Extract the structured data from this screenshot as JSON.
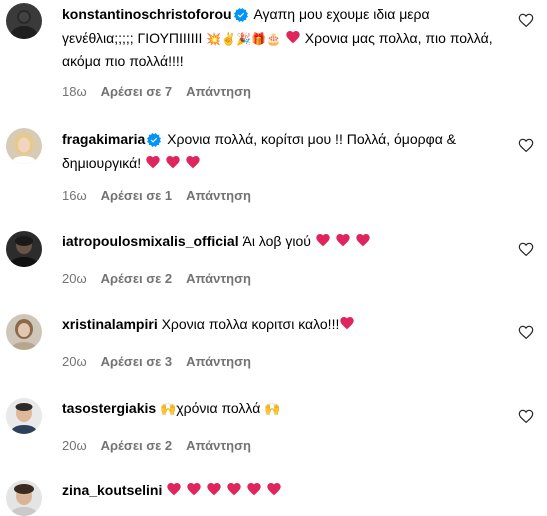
{
  "comments": [
    {
      "username": "konstantinoschristoforou",
      "verified": true,
      "text_before": "Αγαπη μου εχουμε ιδια μερα γενέθλια;;;;; ΓΙΟΥΠΙΙΙΙΙΙ ",
      "emojis_mid": "💥✌️🎉🎁🎂",
      "text_after": " Χρονια μας πολλα, πιο πολλά, ακόμα πιο πολλά!!!!",
      "time": "18ω",
      "likes": "Αρέσει σε 7",
      "reply": "Απάντηση"
    },
    {
      "username": "fragakimaria",
      "verified": true,
      "text": "Χρονια πολλά, κορίτσι μου !! Πολλά, όμορφα & δημιουργικά!",
      "time": "16ω",
      "likes": "Αρέσει σε 1",
      "reply": "Απάντηση"
    },
    {
      "username": "iatropoulosmixalis_official",
      "verified": false,
      "text": "Άι λοβ γιού",
      "time": "20ω",
      "likes": "Αρέσει σε 2",
      "reply": "Απάντηση"
    },
    {
      "username": "xristinalampiri",
      "verified": false,
      "text": "Χρονια πολλα κοριτσι καλο!!!",
      "time": "20ω",
      "likes": "Αρέσει σε 3",
      "reply": "Απάντηση"
    },
    {
      "username": "tasostergiakis",
      "verified": false,
      "text": "χρόνια πολλά",
      "time": "20ω",
      "likes": "Αρέσει σε 2",
      "reply": "Απάντηση"
    },
    {
      "username": "zina_koutselini",
      "verified": false,
      "text": "",
      "time": "",
      "likes": "",
      "reply": ""
    }
  ],
  "colors": {
    "heart": "#e0245e",
    "verified": "#0095f6",
    "meta": "#737373"
  },
  "icons": {
    "like": "heart-outline-icon",
    "verified": "verified-badge-icon"
  }
}
